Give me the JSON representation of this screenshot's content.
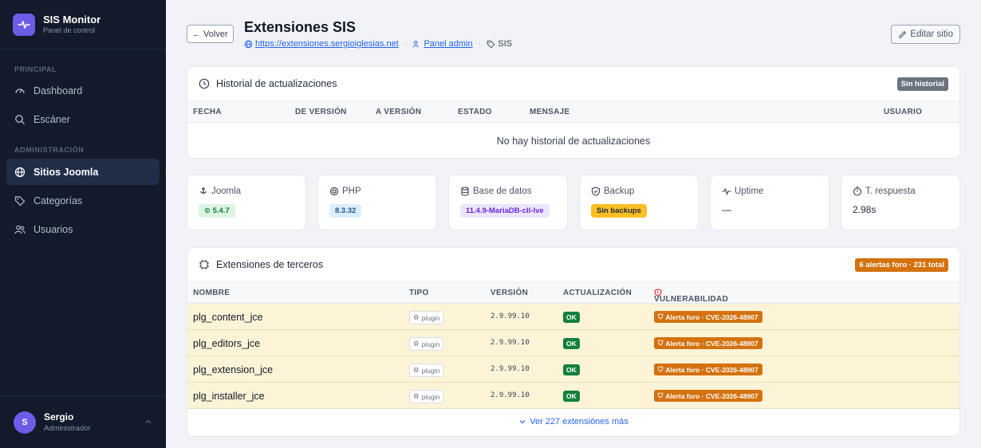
{
  "brand": {
    "title": "SIS Monitor",
    "subtitle": "Panel de control"
  },
  "sidebar": {
    "sections": [
      {
        "label": "PRINCIPAL",
        "items": [
          {
            "label": "Dashboard",
            "icon": "gauge-icon"
          },
          {
            "label": "Escáner",
            "icon": "search-icon"
          }
        ]
      },
      {
        "label": "ADMINISTRACIÓN",
        "items": [
          {
            "label": "Sitios Joomla",
            "icon": "globe-icon",
            "active": true
          },
          {
            "label": "Categorías",
            "icon": "tag-icon"
          },
          {
            "label": "Usuarios",
            "icon": "users-icon"
          }
        ]
      }
    ]
  },
  "user": {
    "initial": "S",
    "name": "Sergio",
    "role": "Administrador"
  },
  "header": {
    "back_label": "← Volver",
    "title": "Extensiones SIS",
    "url": "https://extensiones.sergioiglesias.net",
    "admin_label": "Panel admin",
    "category": "SIS",
    "edit_label": "Editar sitio"
  },
  "history": {
    "title": "Historial de actualizaciones",
    "badge": "Sin historial",
    "columns": [
      "FECHA",
      "DE VERSIÓN",
      "A VERSIÓN",
      "ESTADO",
      "MENSAJE",
      "USUARIO"
    ],
    "empty": "No hay historial de actualizaciones"
  },
  "stats": [
    {
      "label": "Joomla",
      "value": "⊙ 5.4.7",
      "style": "green",
      "icon": "joomla-icon"
    },
    {
      "label": "PHP",
      "value": "8.3.32",
      "style": "blue",
      "icon": "chip-icon"
    },
    {
      "label": "Base de datos",
      "value": "11.4.9-MariaDB-cll-lve",
      "style": "purple",
      "icon": "database-icon"
    },
    {
      "label": "Backup",
      "value": "Sin backups",
      "style": "yellow",
      "icon": "shield-icon"
    },
    {
      "label": "Uptime",
      "value": "—",
      "style": "plain",
      "icon": "pulse-icon"
    },
    {
      "label": "T. respuesta",
      "value": "2.98s",
      "style": "plain",
      "icon": "timer-icon"
    }
  ],
  "extensions": {
    "title": "Extensiones de terceros",
    "badge": "6 alertas foro · 231 total",
    "columns": [
      "NOMBRE",
      "TIPO",
      "VERSIÓN",
      "ACTUALIZACIÓN",
      "VULNERABILIDAD"
    ],
    "rows": [
      {
        "name": "plg_content_jce",
        "type": "plugin",
        "version": "2.9.99.10",
        "status": "OK",
        "vuln": "Alerta foro · CVE-2026-48907"
      },
      {
        "name": "plg_editors_jce",
        "type": "plugin",
        "version": "2.9.99.10",
        "status": "OK",
        "vuln": "Alerta foro · CVE-2026-48907"
      },
      {
        "name": "plg_extension_jce",
        "type": "plugin",
        "version": "2.9.99.10",
        "status": "OK",
        "vuln": "Alerta foro · CVE-2026-48907"
      },
      {
        "name": "plg_installer_jce",
        "type": "plugin",
        "version": "2.9.99.10",
        "status": "OK",
        "vuln": "Alerta foro · CVE-2026-48907"
      }
    ],
    "more_label": "Ver 227 extensiónes más"
  },
  "colors": {
    "accent": "#6d5ce8",
    "sidebar": "#121a2b",
    "link": "#2563eb",
    "warning": "#d4720f",
    "ok": "#15803d"
  }
}
